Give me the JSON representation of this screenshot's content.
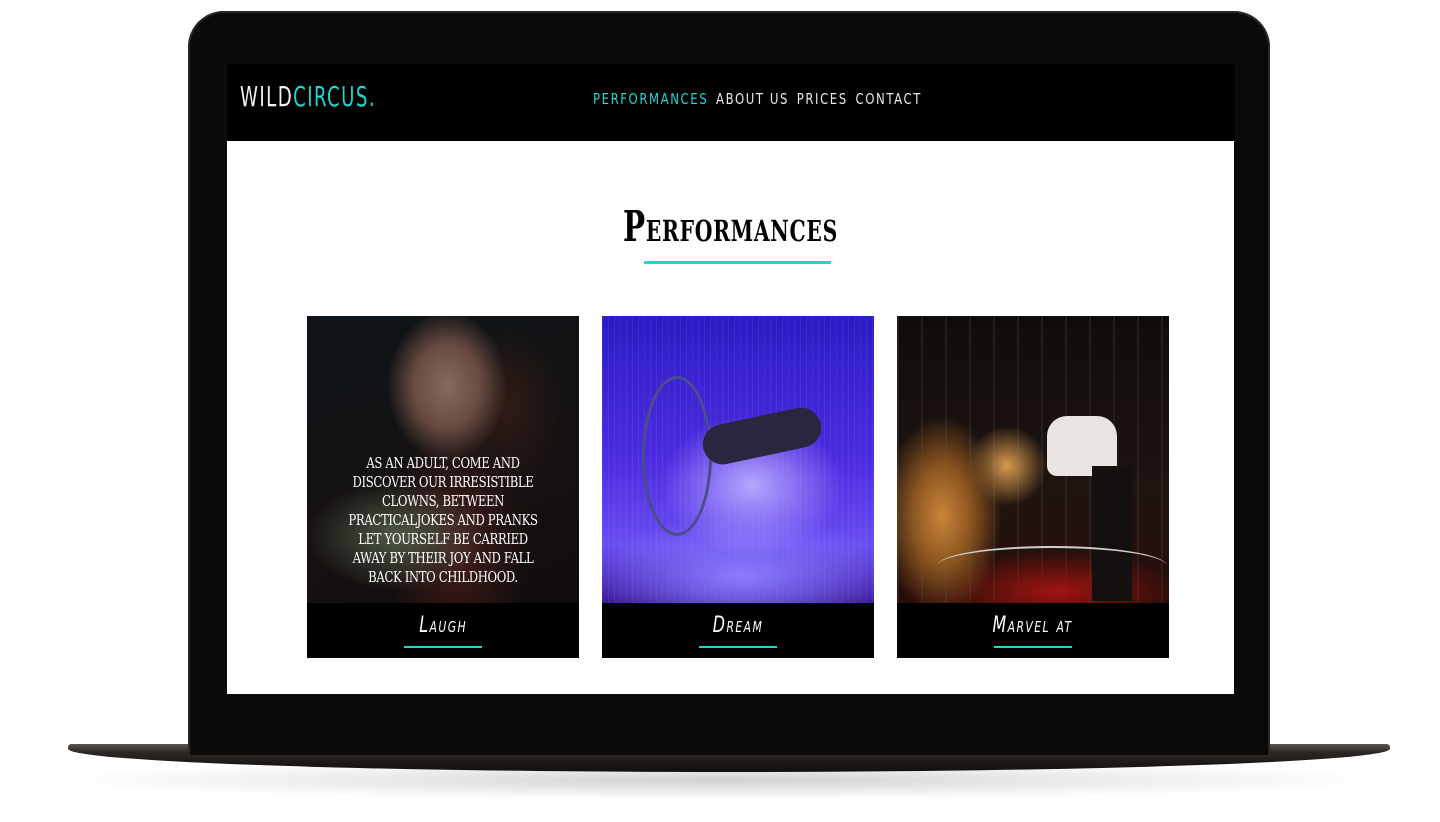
{
  "site": {
    "logo_part_a": "WILD",
    "logo_part_b": "CIRCUS."
  },
  "nav": {
    "items": [
      {
        "label": "PERFORMANCES",
        "active": true
      },
      {
        "label": "ABOUT US",
        "active": false
      },
      {
        "label": "PRICES",
        "active": false
      },
      {
        "label": "CONTACT",
        "active": false
      }
    ]
  },
  "section": {
    "title": "Performances"
  },
  "cards": [
    {
      "label": "Laugh",
      "description": "As an adult, come and discover our irresistible clowns, between practicaljokes and pranks let yourself be carried away by their joy and fall back into childhood."
    },
    {
      "label": "Dream"
    },
    {
      "label": "Marvel at"
    }
  ],
  "colors": {
    "accent": "#1fd6d0",
    "navbar_bg": "#000000",
    "page_bg": "#ffffff"
  }
}
